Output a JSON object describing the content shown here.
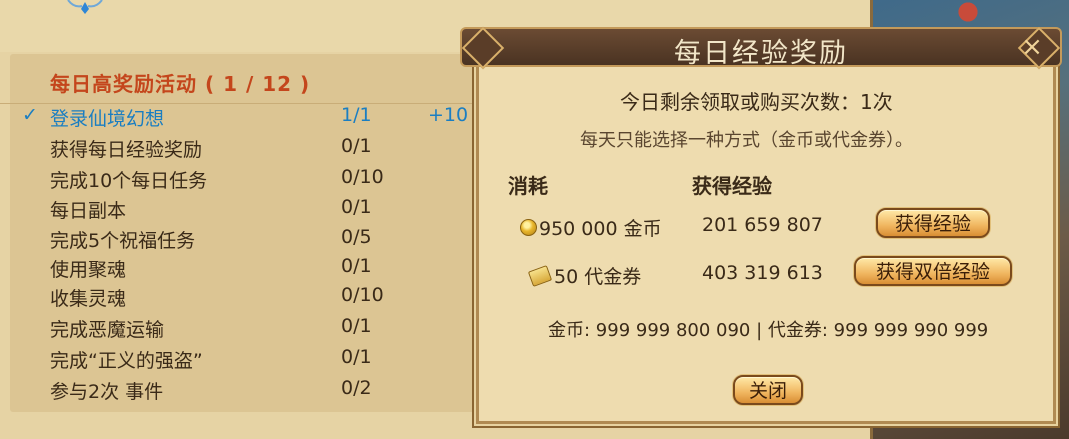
{
  "activity_panel": {
    "title": "每日高奖励活动 ( 1 / 12 )",
    "rows": [
      {
        "check": "✓",
        "name": "登录仙境幻想",
        "progress": "1/1",
        "reward": "+10"
      },
      {
        "name": "获得每日经验奖励",
        "progress": "0/1"
      },
      {
        "name": "完成10个每日任务",
        "progress": "0/10"
      },
      {
        "name": "每日副本",
        "progress": "0/1"
      },
      {
        "name": "完成5个祝福任务",
        "progress": "0/5"
      },
      {
        "name": "使用聚魂",
        "progress": "0/1"
      },
      {
        "name": "收集灵魂",
        "progress": "0/10"
      },
      {
        "name": "完成恶魔运输",
        "progress": "0/1"
      },
      {
        "name": "完成“正义的强盗”",
        "progress": "0/1"
      },
      {
        "name": "参与2次 事件",
        "progress": "0/2"
      }
    ]
  },
  "modal": {
    "title": "每日经验奖励",
    "close_icon": "×",
    "remaining": "今日剩余领取或购买次数：1次",
    "description": "每天只能选择一种方式（金币或代金券）。",
    "cost_header": "消耗",
    "exp_header": "获得经验",
    "options": [
      {
        "cost": "950 000 金币",
        "icon": "gold-coin-icon",
        "exp": "201 659 807",
        "button": "获得经验"
      },
      {
        "cost": "50 代金券",
        "icon": "voucher-icon",
        "exp": "403 319 613",
        "button": "获得双倍经验"
      }
    ],
    "balances": "金币: 999 999 800 090  |  代金券: 999 999 990 999",
    "close_button": "关闭"
  },
  "colors": {
    "accent_title": "#c4461c",
    "completed_blue": "#1a7ec2",
    "panel_bg": "#e6d3a4",
    "header_brown": "#4a3322"
  }
}
